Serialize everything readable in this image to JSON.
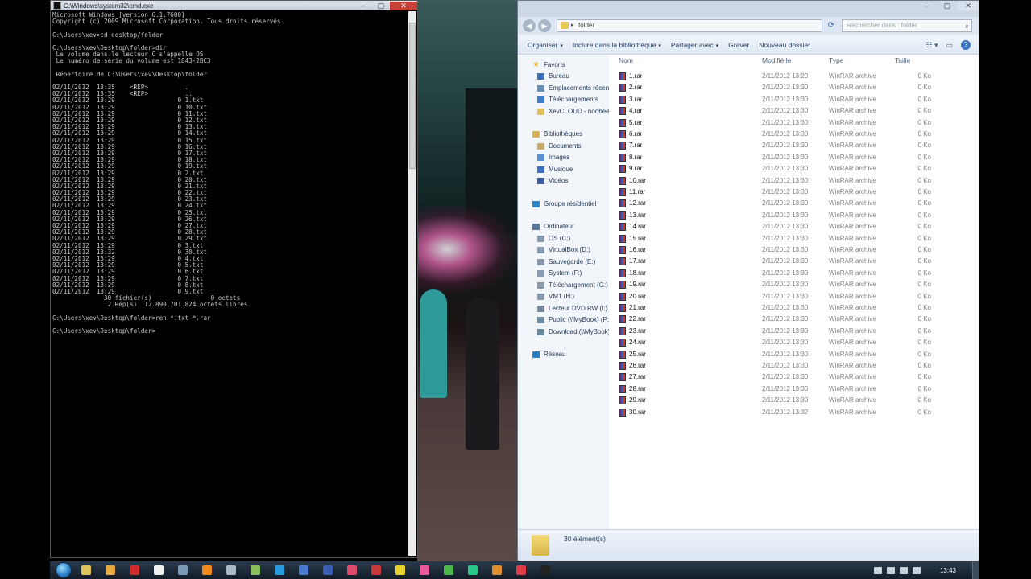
{
  "console": {
    "title": "C:\\Windows\\system32\\cmd.exe",
    "lines": [
      "Microsoft Windows [version 6.1.7600]",
      "Copyright (c) 2009 Microsoft Corporation. Tous droits réservés.",
      "",
      "C:\\Users\\xev>cd desktop/folder",
      "",
      "C:\\Users\\xev\\Desktop\\folder>dir",
      " Le volume dans le lecteur C s'appelle OS",
      " Le numéro de série du volume est 1843-2BC3",
      "",
      " Répertoire de C:\\Users\\xev\\Desktop\\folder",
      "",
      "02/11/2012  13:35    <REP>          .",
      "02/11/2012  13:35    <REP>          ..",
      "02/11/2012  13:29                 0 1.txt",
      "02/11/2012  13:29                 0 10.txt",
      "02/11/2012  13:29                 0 11.txt",
      "02/11/2012  13:29                 0 12.txt",
      "02/11/2012  13:29                 0 13.txt",
      "02/11/2012  13:29                 0 14.txt",
      "02/11/2012  13:29                 0 15.txt",
      "02/11/2012  13:29                 0 16.txt",
      "02/11/2012  13:29                 0 17.txt",
      "02/11/2012  13:29                 0 18.txt",
      "02/11/2012  13:29                 0 19.txt",
      "02/11/2012  13:29                 0 2.txt",
      "02/11/2012  13:29                 0 20.txt",
      "02/11/2012  13:29                 0 21.txt",
      "02/11/2012  13:29                 0 22.txt",
      "02/11/2012  13:29                 0 23.txt",
      "02/11/2012  13:29                 0 24.txt",
      "02/11/2012  13:29                 0 25.txt",
      "02/11/2012  13:29                 0 26.txt",
      "02/11/2012  13:29                 0 27.txt",
      "02/11/2012  13:29                 0 28.txt",
      "02/11/2012  13:29                 0 29.txt",
      "02/11/2012  13:29                 0 3.txt",
      "02/11/2012  13:32                 0 30.txt",
      "02/11/2012  13:29                 0 4.txt",
      "02/11/2012  13:29                 0 5.txt",
      "02/11/2012  13:29                 0 6.txt",
      "02/11/2012  13:29                 0 7.txt",
      "02/11/2012  13:29                 0 8.txt",
      "02/11/2012  13:29                 0 9.txt",
      "              30 fichier(s)                0 octets",
      "               2 Rép(s)  12.890.701.824 octets libres",
      "",
      "C:\\Users\\xev\\Desktop\\folder>ren *.txt *.rar",
      "",
      "C:\\Users\\xev\\Desktop\\folder>"
    ]
  },
  "explorer": {
    "address": "folder",
    "search_placeholder": "Rechercher dans : folder",
    "toolbar": [
      "Organiser",
      "Inclure dans la bibliothèque",
      "Partager avec",
      "Graver",
      "Nouveau dossier"
    ],
    "toolbar_dropdown": [
      true,
      true,
      true,
      false,
      false
    ],
    "nav": [
      {
        "label": "Favoris",
        "icon": "star-icon",
        "indent": 0,
        "color": "#e8b73a"
      },
      {
        "label": "Bureau",
        "icon": "desktop-icon",
        "indent": 1,
        "color": "#3f6fb8"
      },
      {
        "label": "Emplacements récents",
        "icon": "recent-places-icon",
        "indent": 1,
        "color": "#6a8fbf"
      },
      {
        "label": "Téléchargements",
        "icon": "downloads-folder-icon",
        "indent": 1,
        "color": "#3f7fc8"
      },
      {
        "label": "XevCLOUD - noobeeNAS",
        "icon": "folder-icon",
        "indent": 1,
        "color": "#e2c15a"
      },
      {
        "label": "Bibliothèques",
        "icon": "libraries-icon",
        "indent": 0,
        "color": "#d6b35a"
      },
      {
        "label": "Documents",
        "icon": "documents-icon",
        "indent": 1,
        "color": "#c9ad6a"
      },
      {
        "label": "Images",
        "icon": "images-icon",
        "indent": 1,
        "color": "#5a8fd0"
      },
      {
        "label": "Musique",
        "icon": "music-icon",
        "indent": 1,
        "color": "#3d6fbf"
      },
      {
        "label": "Vidéos",
        "icon": "videos-icon",
        "indent": 1,
        "color": "#3d5f9f"
      },
      {
        "label": "Groupe résidentiel",
        "icon": "homegroup-icon",
        "indent": 0,
        "color": "#2f86c9"
      },
      {
        "label": "Ordinateur",
        "icon": "computer-icon",
        "indent": 0,
        "color": "#5b7aa0"
      },
      {
        "label": "OS (C:)",
        "icon": "drive-icon",
        "indent": 1,
        "color": "#8a9aad"
      },
      {
        "label": "VirtualBox (D:)",
        "icon": "drive-icon",
        "indent": 1,
        "color": "#8a9aad"
      },
      {
        "label": "Sauvegarde (E:)",
        "icon": "drive-icon",
        "indent": 1,
        "color": "#8a9aad"
      },
      {
        "label": "System (F:)",
        "icon": "drive-icon",
        "indent": 1,
        "color": "#8a9aad"
      },
      {
        "label": "Téléchargement (G:)",
        "icon": "drive-icon",
        "indent": 1,
        "color": "#8a9aad"
      },
      {
        "label": "VM1 (H:)",
        "icon": "drive-icon",
        "indent": 1,
        "color": "#8a9aad"
      },
      {
        "label": "Lecteur DVD RW (I:)",
        "icon": "dvd-drive-icon",
        "indent": 1,
        "color": "#7a8a9a"
      },
      {
        "label": "Public (\\\\MyBook) (P:)",
        "icon": "network-drive-icon",
        "indent": 1,
        "color": "#6a8aa0"
      },
      {
        "label": "Download (\\\\MyBook) (Q:)",
        "icon": "network-drive-icon",
        "indent": 1,
        "color": "#6a8aa0"
      },
      {
        "label": "Réseau",
        "icon": "network-icon",
        "indent": 0,
        "color": "#2f7fc5"
      }
    ],
    "columns": [
      "Nom",
      "Modifié le",
      "Type",
      "Taille"
    ],
    "files": [
      {
        "name": "1.rar",
        "date": "2/11/2012 13:29",
        "type": "WinRAR archive",
        "size": "0 Ko"
      },
      {
        "name": "2.rar",
        "date": "2/11/2012 13:30",
        "type": "WinRAR archive",
        "size": "0 Ko"
      },
      {
        "name": "3.rar",
        "date": "2/11/2012 13:30",
        "type": "WinRAR archive",
        "size": "0 Ko"
      },
      {
        "name": "4.rar",
        "date": "2/11/2012 13:30",
        "type": "WinRAR archive",
        "size": "0 Ko"
      },
      {
        "name": "5.rar",
        "date": "2/11/2012 13:30",
        "type": "WinRAR archive",
        "size": "0 Ko"
      },
      {
        "name": "6.rar",
        "date": "2/11/2012 13:30",
        "type": "WinRAR archive",
        "size": "0 Ko"
      },
      {
        "name": "7.rar",
        "date": "2/11/2012 13:30",
        "type": "WinRAR archive",
        "size": "0 Ko"
      },
      {
        "name": "8.rar",
        "date": "2/11/2012 13:30",
        "type": "WinRAR archive",
        "size": "0 Ko"
      },
      {
        "name": "9.rar",
        "date": "2/11/2012 13:30",
        "type": "WinRAR archive",
        "size": "0 Ko"
      },
      {
        "name": "10.rar",
        "date": "2/11/2012 13:30",
        "type": "WinRAR archive",
        "size": "0 Ko"
      },
      {
        "name": "11.rar",
        "date": "2/11/2012 13:30",
        "type": "WinRAR archive",
        "size": "0 Ko"
      },
      {
        "name": "12.rar",
        "date": "2/11/2012 13:30",
        "type": "WinRAR archive",
        "size": "0 Ko"
      },
      {
        "name": "13.rar",
        "date": "2/11/2012 13:30",
        "type": "WinRAR archive",
        "size": "0 Ko"
      },
      {
        "name": "14.rar",
        "date": "2/11/2012 13:30",
        "type": "WinRAR archive",
        "size": "0 Ko"
      },
      {
        "name": "15.rar",
        "date": "2/11/2012 13:30",
        "type": "WinRAR archive",
        "size": "0 Ko"
      },
      {
        "name": "16.rar",
        "date": "2/11/2012 13:30",
        "type": "WinRAR archive",
        "size": "0 Ko"
      },
      {
        "name": "17.rar",
        "date": "2/11/2012 13:30",
        "type": "WinRAR archive",
        "size": "0 Ko"
      },
      {
        "name": "18.rar",
        "date": "2/11/2012 13:30",
        "type": "WinRAR archive",
        "size": "0 Ko"
      },
      {
        "name": "19.rar",
        "date": "2/11/2012 13:30",
        "type": "WinRAR archive",
        "size": "0 Ko"
      },
      {
        "name": "20.rar",
        "date": "2/11/2012 13:30",
        "type": "WinRAR archive",
        "size": "0 Ko"
      },
      {
        "name": "21.rar",
        "date": "2/11/2012 13:30",
        "type": "WinRAR archive",
        "size": "0 Ko"
      },
      {
        "name": "22.rar",
        "date": "2/11/2012 13:30",
        "type": "WinRAR archive",
        "size": "0 Ko"
      },
      {
        "name": "23.rar",
        "date": "2/11/2012 13:30",
        "type": "WinRAR archive",
        "size": "0 Ko"
      },
      {
        "name": "24.rar",
        "date": "2/11/2012 13:30",
        "type": "WinRAR archive",
        "size": "0 Ko"
      },
      {
        "name": "25.rar",
        "date": "2/11/2012 13:30",
        "type": "WinRAR archive",
        "size": "0 Ko"
      },
      {
        "name": "26.rar",
        "date": "2/11/2012 13:30",
        "type": "WinRAR archive",
        "size": "0 Ko"
      },
      {
        "name": "27.rar",
        "date": "2/11/2012 13:30",
        "type": "WinRAR archive",
        "size": "0 Ko"
      },
      {
        "name": "28.rar",
        "date": "2/11/2012 13:30",
        "type": "WinRAR archive",
        "size": "0 Ko"
      },
      {
        "name": "29.rar",
        "date": "2/11/2012 13:30",
        "type": "WinRAR archive",
        "size": "0 Ko"
      },
      {
        "name": "30.rar",
        "date": "2/11/2012 13:32",
        "type": "WinRAR archive",
        "size": "0 Ko"
      }
    ],
    "status_count": "30 élément(s)"
  },
  "taskbar": {
    "apps": [
      {
        "name": "explorer-icon",
        "color": "#e0c25a"
      },
      {
        "name": "media-player-icon",
        "color": "#e8a83a"
      },
      {
        "name": "opera-icon",
        "color": "#d02a2a"
      },
      {
        "name": "chat-icon",
        "color": "#f0f0f0"
      },
      {
        "name": "monitor-icon",
        "color": "#7a9ab8"
      },
      {
        "name": "vlc-icon",
        "color": "#f08a1a"
      },
      {
        "name": "tool-icon",
        "color": "#aab8c8"
      },
      {
        "name": "notepad-icon",
        "color": "#8ac05a"
      },
      {
        "name": "skype-icon",
        "color": "#2a9ae0"
      },
      {
        "name": "network-tool-icon",
        "color": "#4a7ad0"
      },
      {
        "name": "virtualbox-icon",
        "color": "#3a5ab8"
      },
      {
        "name": "paint-icon",
        "color": "#e04a6a"
      },
      {
        "name": "app-red-icon",
        "color": "#c83a3a"
      },
      {
        "name": "app-yellow-icon",
        "color": "#e8d02a"
      },
      {
        "name": "app-pink-icon",
        "color": "#e85a9a"
      },
      {
        "name": "chrome-icon",
        "color": "#4ab84a"
      },
      {
        "name": "app-green-icon",
        "color": "#2ac88a"
      },
      {
        "name": "app-orange-icon",
        "color": "#e0902a"
      },
      {
        "name": "app-redwhite-icon",
        "color": "#e03a4a"
      },
      {
        "name": "cmd-icon",
        "color": "#222222"
      }
    ],
    "time": "13:43"
  }
}
